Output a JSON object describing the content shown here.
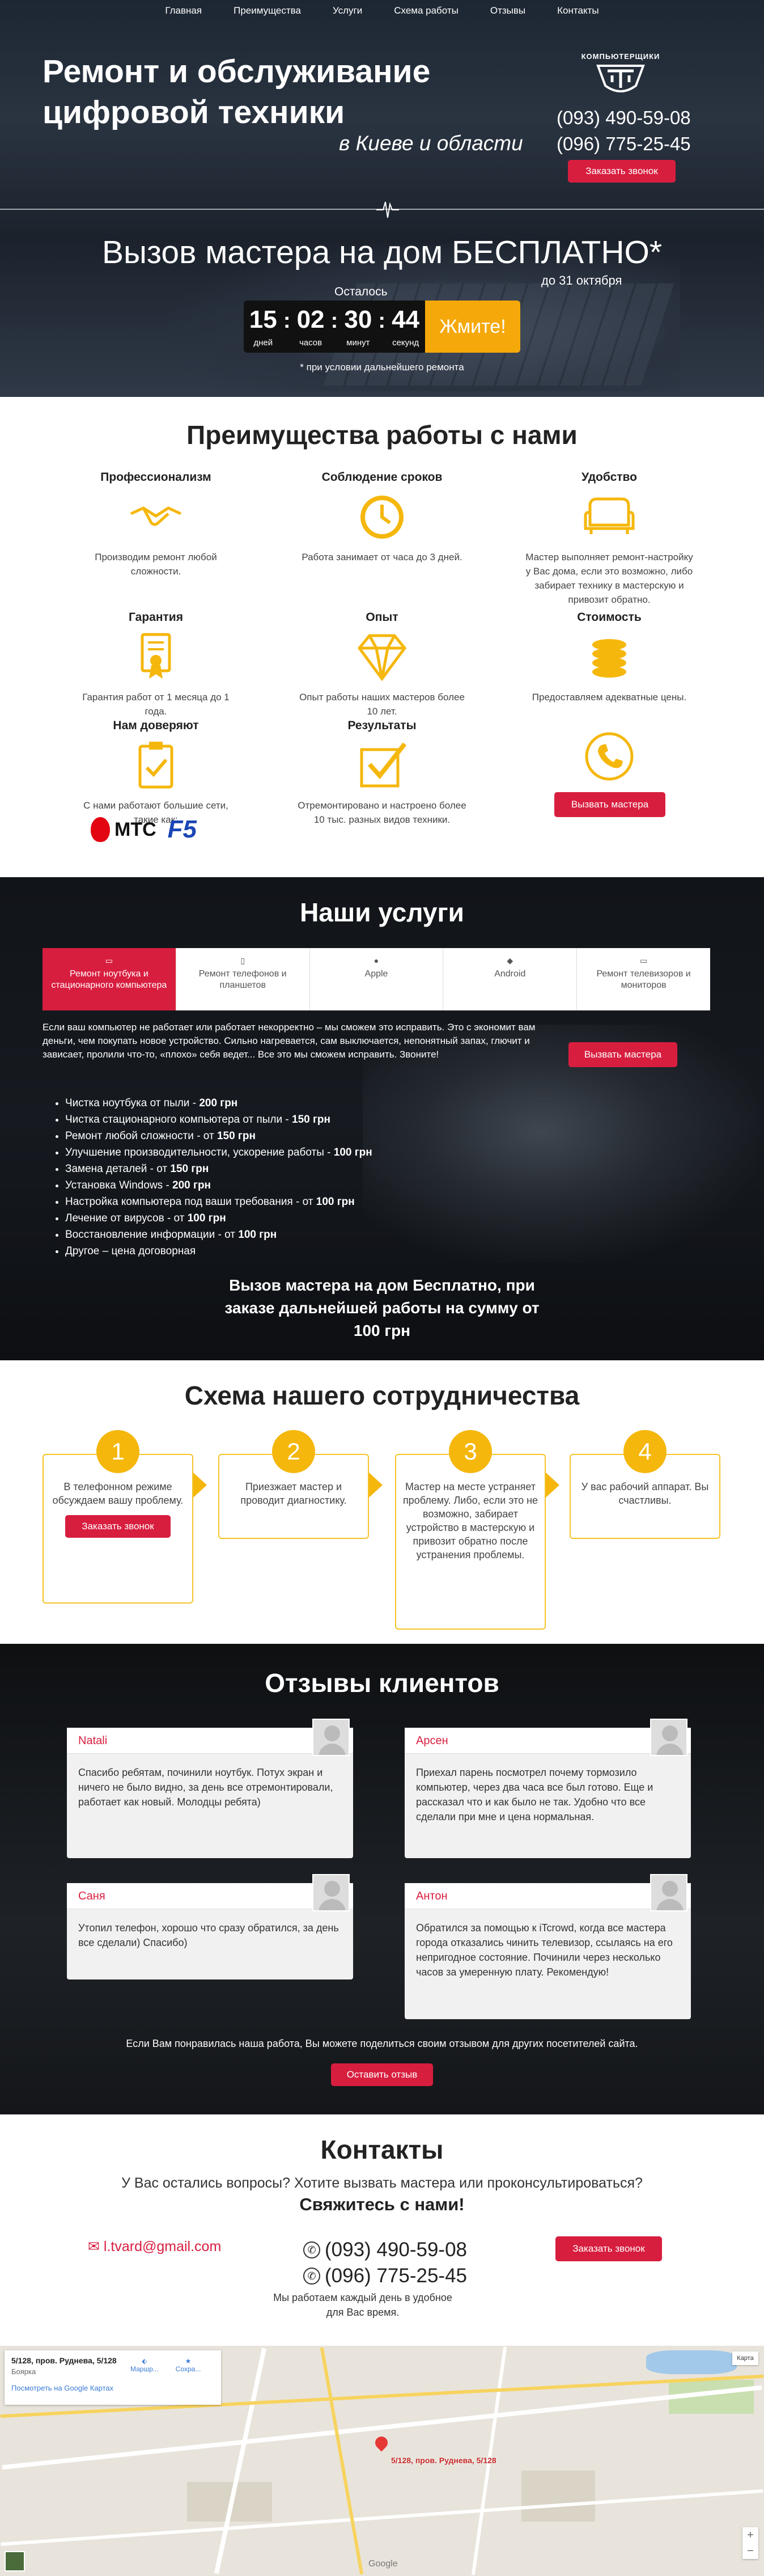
{
  "nav": [
    "Главная",
    "Преимущества",
    "Услуги",
    "Схема работы",
    "Отзывы",
    "Контакты"
  ],
  "hero": {
    "title": "Ремонт и обслуживание цифровой техники",
    "subtitle": "в Киеве и области",
    "logo_text": "КОМПЬЮТЕРЩИКИ",
    "phone1": "(093) 490-59-08",
    "phone2": "(096) 775-25-45",
    "call_button": "Заказать звонок",
    "offer": "Вызов мастера на дом БЕСПЛАТНО*",
    "offer_date": "до 31 октября",
    "remain_label": "Осталось",
    "timer": [
      {
        "value": "15",
        "label": "дней"
      },
      {
        "value": "02",
        "label": "часов"
      },
      {
        "value": "30",
        "label": "минут"
      },
      {
        "value": "44",
        "label": "секунд"
      }
    ],
    "push_button": "Жмите!",
    "condition": "* при условии дальнейшего ремонта"
  },
  "advantages": {
    "title": "Преимущества работы с нами",
    "items": [
      {
        "title": "Профессионализм",
        "text": "Производим ремонт любой сложности.",
        "icon": "handshake-icon"
      },
      {
        "title": "Соблюдение сроков",
        "text": "Работа занимает от часа до 3 дней.",
        "icon": "clock-icon"
      },
      {
        "title": "Удобство",
        "text": "Мастер выполняет ремонт-настройку у Вас дома, если это возможно, либо забирает технику в мастерскую и привозит обратно.",
        "icon": "sofa-icon"
      },
      {
        "title": "Гарантия",
        "text": "Гарантия работ от 1 месяца до 1 года.",
        "icon": "certificate-icon"
      },
      {
        "title": "Опыт",
        "text": "Опыт работы наших мастеров более 10 лет.",
        "icon": "diamond-icon"
      },
      {
        "title": "Стоимость",
        "text": "Предоставляем адекватные цены.",
        "icon": "coins-icon"
      },
      {
        "title": "Нам доверяют",
        "text": "С нами работают большие сети, такие как:",
        "icon": "clipboard-check-icon"
      },
      {
        "title": "Результаты",
        "text": "Отремонтировано и настроено более 10 тыс. разных видов техники.",
        "icon": "checkbox-icon"
      }
    ],
    "call_button": "Вызвать мастера",
    "partner1": "МТС",
    "partner2": "F5"
  },
  "services": {
    "title": "Наши услуги",
    "tabs": [
      "Ремонт ноутбука и стационарного компьютера",
      "Ремонт телефонов и планшетов",
      "Apple",
      "Android",
      "Ремонт телевизоров и мониторов"
    ],
    "intro": "Если ваш компьютер не работает или работает некорректно – мы сможем это исправить. Это с экономит вам деньги, чем покупать новое устройство. Сильно нагревается, сам выключается, непонятный запах, глючит и зависает, пролили что-то, «плохо» себя ведет... Все это мы сможем исправить. Звоните!",
    "call_button": "Вызвать мастера",
    "list": [
      {
        "text": "Чистка ноутбука от пыли - ",
        "price": "200 грн"
      },
      {
        "text": "Чистка стационарного компьютера от пыли - ",
        "price": "150 грн"
      },
      {
        "text": "Ремонт любой сложности - от ",
        "price": "150 грн"
      },
      {
        "text": "Улучшение производительности, ускорение работы - ",
        "price": "100 грн"
      },
      {
        "text": "Замена деталей - от ",
        "price": "150 грн"
      },
      {
        "text": "Установка Windows - ",
        "price": "200 грн"
      },
      {
        "text": "Настройка компьютера под ваши требования - от ",
        "price": "100 грн"
      },
      {
        "text": "Лечение от вирусов - от ",
        "price": "100 грн"
      },
      {
        "text": "Восстановление информации - от ",
        "price": "100 грн"
      },
      {
        "text": "Другое – цена договорная",
        "price": ""
      }
    ],
    "free_call": "Вызов мастера на дом Бесплатно, при заказе дальнейшей работы на сумму от 100 грн"
  },
  "scheme": {
    "title": "Схема нашего сотрудничества",
    "steps": [
      {
        "num": "1",
        "text": "В телефонном режиме обсуждаем вашу проблему."
      },
      {
        "num": "2",
        "text": "Приезжает мастер и проводит диагностику."
      },
      {
        "num": "3",
        "text": "Мастер на месте устраняет проблему. Либо, если это не возможно, забирает устройство в мастерскую и привозит обратно после устранения проблемы."
      },
      {
        "num": "4",
        "text": "У вас рабочий аппарат. Вы счастливы."
      }
    ],
    "call_button": "Заказать звонок"
  },
  "reviews": {
    "title": "Отзывы клиентов",
    "items": [
      {
        "name": "Natali",
        "text": "Спасибо ребятам, починили ноутбук. Потух экран и ничего не было видно, за день все отремонтировали, работает как новый. Молодцы ребята)"
      },
      {
        "name": "Арсен",
        "text": "Приехал парень посмотрел почему тормозило компьютер, через два часа все был готово. Еще и рассказал что и как было не так. Удобно что все сделали при мне и цена нормальная."
      },
      {
        "name": "Саня",
        "text": "Утопил телефон, хорошо что сразу обратился, за день все сделали) Спасибо)"
      },
      {
        "name": "Антон",
        "text": "Обратился за помощью к iTcrowd, когда все мастера города отказались чинить телевизор, ссылаясь на его непригодное состояние. Починили через несколько часов за умеренную плату. Рекомендую!"
      }
    ],
    "note": "Если Вам понравилась наша работа, Вы можете поделиться своим отзывом для других посетителей сайта.",
    "button": "Оставить отзыв"
  },
  "contacts": {
    "title": "Контакты",
    "question": "У Вас остались вопросы? Хотите вызвать мастера или проконсультироваться?",
    "cta": "Свяжитесь с нами!",
    "email": "l.tvard@gmail.com",
    "phone1": "(093) 490-59-08",
    "phone2": "(096) 775-25-45",
    "hours": "Мы работаем каждый день в удобное для Вас время.",
    "call_button": "Заказать звонок"
  },
  "map": {
    "address": "5/128, пров. Руднева, 5/128",
    "city": "Боярка",
    "link": "Посмотреть на Google Картах",
    "route": "Маршр...",
    "save": "Сохра...",
    "pin_label": "5/128, пров. Руднева, 5/128",
    "google": "Google",
    "maptype": "Карта"
  }
}
